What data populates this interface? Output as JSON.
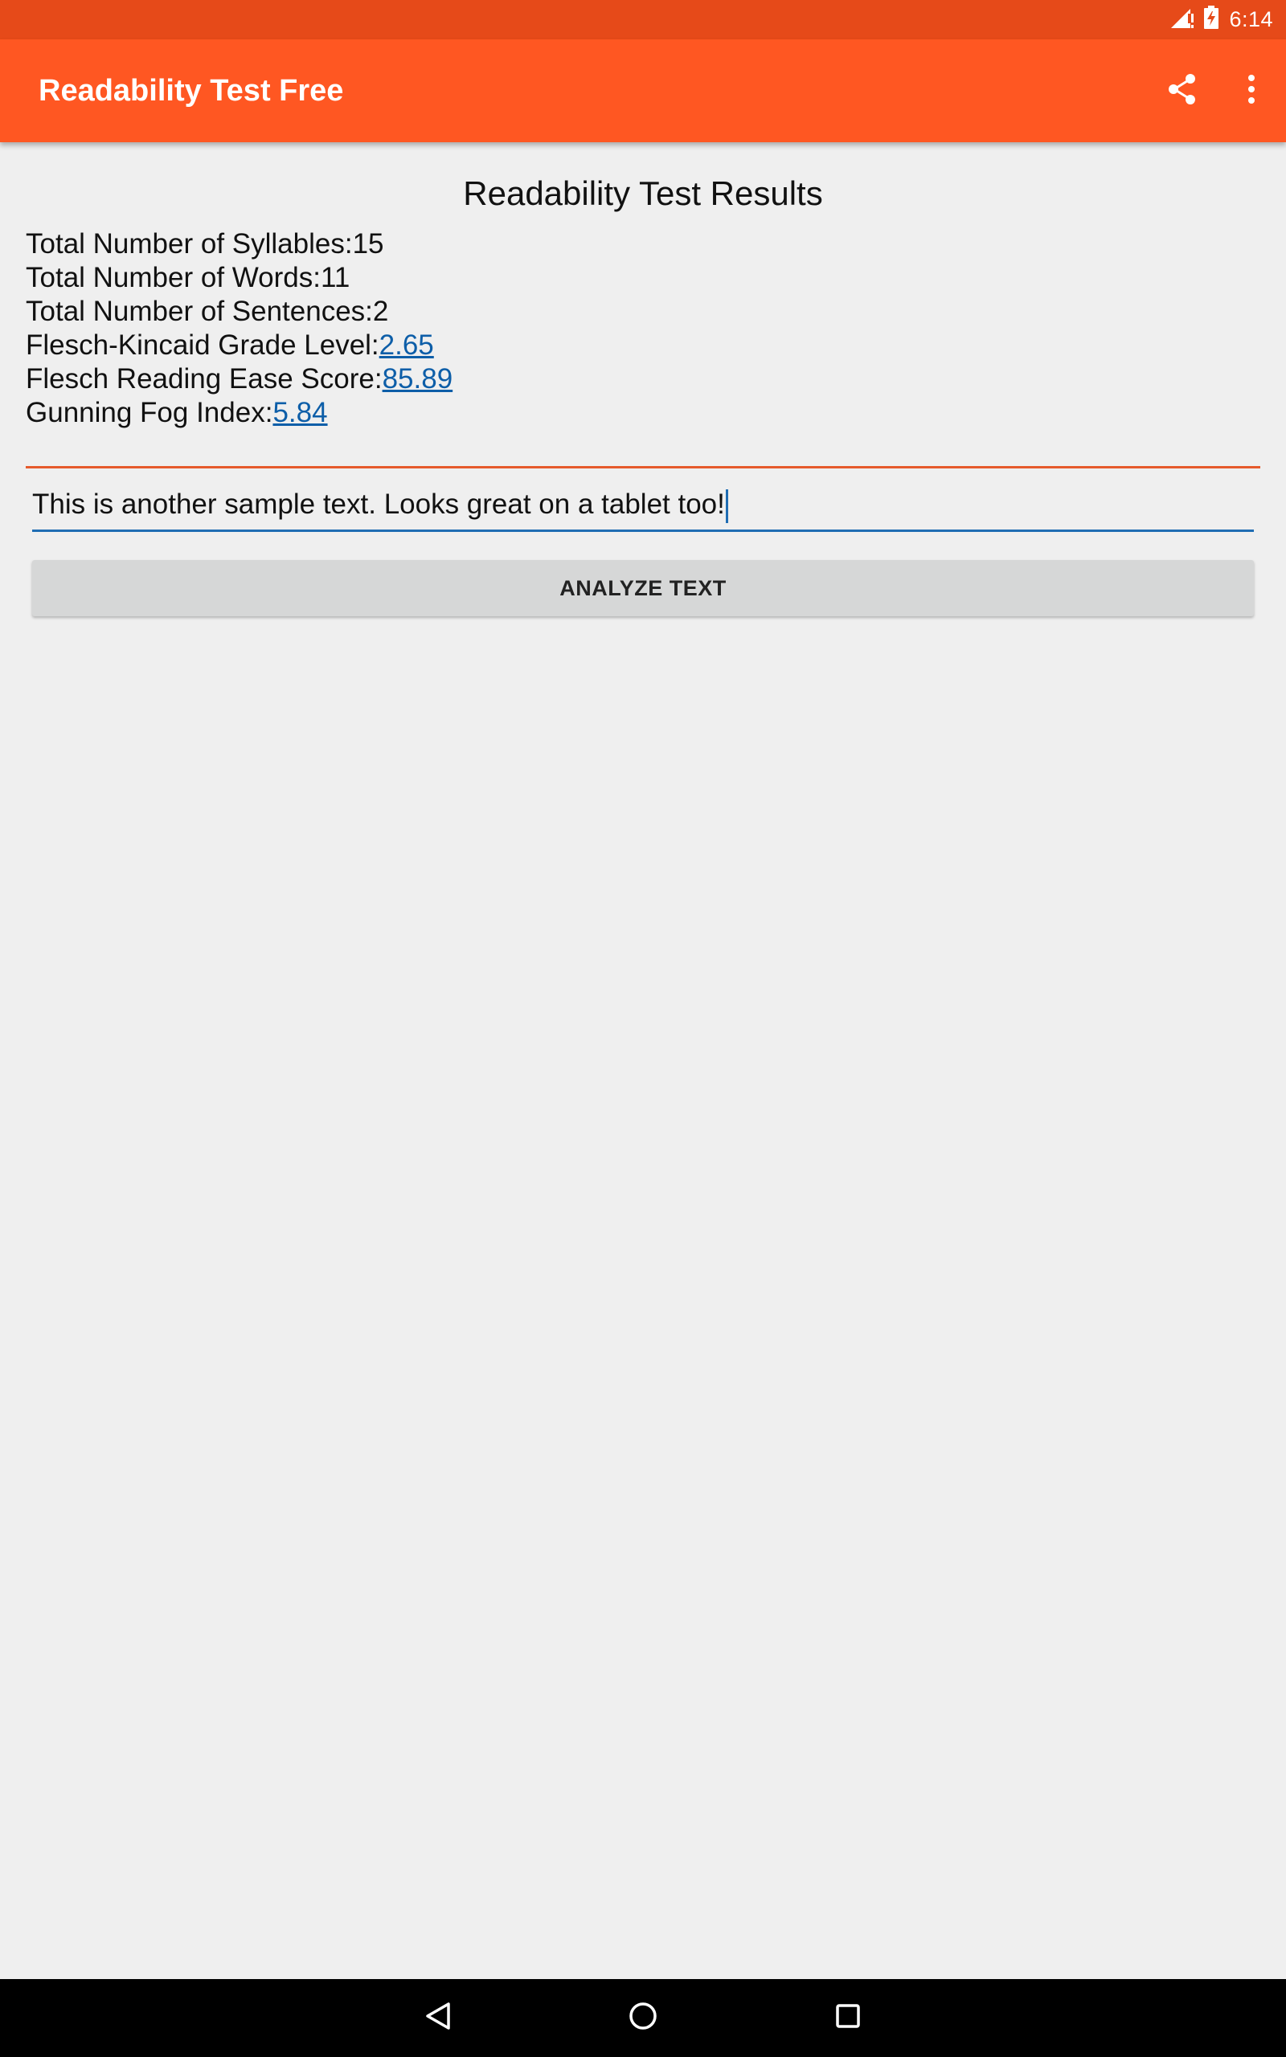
{
  "status_bar": {
    "time": "6:14",
    "icons": [
      "signal-icon",
      "battery-charging-icon"
    ]
  },
  "app_bar": {
    "title": "Readability Test Free",
    "actions": [
      "share-icon",
      "overflow-menu-icon"
    ]
  },
  "results": {
    "heading": "Readability Test Results",
    "syllables_label": "Total Number of Syllables:",
    "syllables_value": "15",
    "words_label": "Total Number of Words:",
    "words_value": "11",
    "sentences_label": "Total Number of Sentences:",
    "sentences_value": "2",
    "fk_grade_label": "Flesch-Kincaid Grade Level:",
    "fk_grade_value": "2.65",
    "flesch_ease_label": "Flesch Reading Ease Score:",
    "flesch_ease_value": "85.89",
    "fog_label": "Gunning Fog Index:",
    "fog_value": "5.84"
  },
  "input": {
    "value": "This is another sample text.  Looks great on a tablet too!"
  },
  "analyze_button": {
    "label": "ANALYZE TEXT"
  },
  "nav_bar": {
    "buttons": [
      "back-icon",
      "home-icon",
      "recents-icon"
    ]
  },
  "colors": {
    "status_bar": "#e64a19",
    "app_bar": "#ff5722",
    "link": "#0d5ea8",
    "input_underline": "#1f6db3",
    "divider": "#e65a2c",
    "background": "#efefef",
    "button": "#d6d7d7"
  }
}
